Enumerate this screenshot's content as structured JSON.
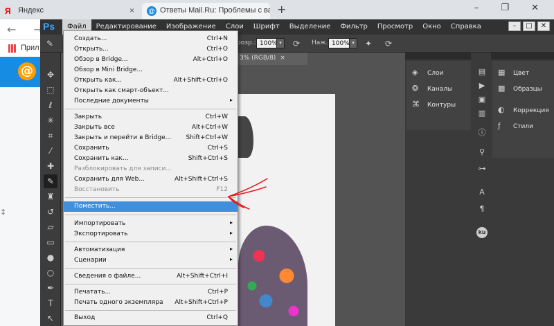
{
  "browser": {
    "tabs": [
      {
        "title": "Яндекс",
        "favicon": "Я",
        "close": "×"
      },
      {
        "title": "Ответы Mail.Ru: Проблемы с ва",
        "favicon": "@",
        "close": "×"
      }
    ],
    "new_tab": "+",
    "window_controls": "– ❐ ✕",
    "nav": "← →",
    "bookmarks_label": "Прил",
    "mail_logo": "@"
  },
  "ps": {
    "logo": "Ps",
    "menu": [
      "Файл",
      "Редактирование",
      "Изображение",
      "Слои",
      "Шрифт",
      "Выделение",
      "Фильтр",
      "Просмотр",
      "Окно",
      "Справка"
    ],
    "window_buttons": [
      "–",
      "□",
      "✕"
    ],
    "options": {
      "opacity_label": "розр.:",
      "opacity_value": "100%",
      "flow_label": "Наж.:",
      "flow_value": "100%"
    },
    "doc_tab": {
      "title": "3% (RGB/8)",
      "close": "×"
    },
    "panels_left": [
      {
        "label": "Слои",
        "icon": "layers-icon"
      },
      {
        "label": "Каналы",
        "icon": "channels-icon"
      },
      {
        "label": "Контуры",
        "icon": "paths-icon"
      }
    ],
    "panels_right": [
      {
        "label": "Цвет",
        "icon": "color-icon"
      },
      {
        "label": "Образцы",
        "icon": "swatches-icon"
      },
      {
        "label": "Коррекция",
        "icon": "adjustments-icon"
      },
      {
        "label": "Стили",
        "icon": "styles-icon"
      }
    ],
    "mini_ku": "ku"
  },
  "file_menu": {
    "items": [
      {
        "label": "Создать...",
        "shortcut": "Ctrl+N"
      },
      {
        "label": "Открыть...",
        "shortcut": "Ctrl+O"
      },
      {
        "label": "Обзор в Bridge...",
        "shortcut": "Alt+Ctrl+O"
      },
      {
        "label": "Обзор в Mini Bridge...",
        "shortcut": ""
      },
      {
        "label": "Открыть как...",
        "shortcut": "Alt+Shift+Ctrl+O"
      },
      {
        "label": "Открыть как смарт-объект...",
        "shortcut": ""
      },
      {
        "label": "Последние документы",
        "shortcut": ""
      },
      {
        "label": "Закрыть",
        "shortcut": "Ctrl+W"
      },
      {
        "label": "Закрыть все",
        "shortcut": "Alt+Ctrl+W"
      },
      {
        "label": "Закрыть и перейти в Bridge...",
        "shortcut": "Shift+Ctrl+W"
      },
      {
        "label": "Сохранить",
        "shortcut": "Ctrl+S"
      },
      {
        "label": "Сохранить как...",
        "shortcut": "Shift+Ctrl+S"
      },
      {
        "label": "Разблокировать для записи...",
        "shortcut": ""
      },
      {
        "label": "Сохранить для Web...",
        "shortcut": "Alt+Shift+Ctrl+S"
      },
      {
        "label": "Восстановить",
        "shortcut": "F12"
      },
      {
        "label": "Поместить...",
        "shortcut": ""
      },
      {
        "label": "Импортировать",
        "shortcut": ""
      },
      {
        "label": "Экспортировать",
        "shortcut": ""
      },
      {
        "label": "Автоматизация",
        "shortcut": ""
      },
      {
        "label": "Сценарии",
        "shortcut": ""
      },
      {
        "label": "Сведения о файле...",
        "shortcut": "Alt+Shift+Ctrl+I"
      },
      {
        "label": "Печатать...",
        "shortcut": "Ctrl+P"
      },
      {
        "label": "Печать одного экземпляра",
        "shortcut": "Alt+Shift+Ctrl+P"
      },
      {
        "label": "Выход",
        "shortcut": "Ctrl+Q"
      }
    ],
    "submenu_arrow": "▸"
  },
  "colors": {
    "highlight": "#3f8fdc",
    "annotation": "#e8141c"
  }
}
